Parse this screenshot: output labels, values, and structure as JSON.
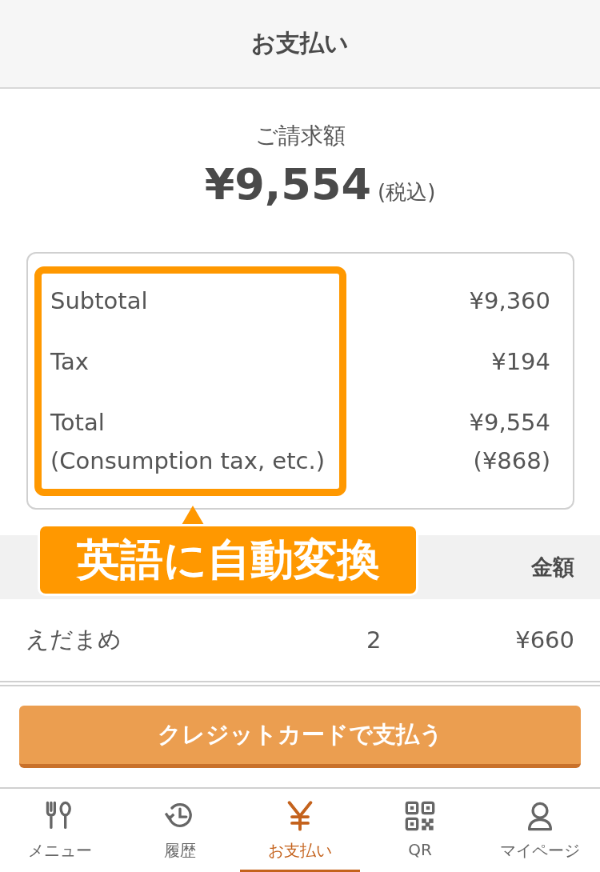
{
  "header": {
    "title": "お支払い"
  },
  "bill": {
    "label": "ご請求額",
    "amount": "¥9,554",
    "tax_note": "(税込)"
  },
  "summary": [
    {
      "label": "Subtotal",
      "value": "¥9,360"
    },
    {
      "label": "Tax",
      "value": "¥194"
    },
    {
      "label": "Total",
      "value": "¥9,554"
    },
    {
      "label": "(Consumption tax, etc.)",
      "value": "(¥868)"
    }
  ],
  "table": {
    "columns": [
      "金額"
    ],
    "rows": [
      {
        "item": "えだまめ",
        "qty": "2",
        "amount": "¥660"
      }
    ]
  },
  "pay_button": "クレジットカードで支払う",
  "annotation": {
    "text": "英語に自動変換"
  },
  "nav": [
    {
      "kind": "menu",
      "label": "メニュー",
      "selected": false
    },
    {
      "kind": "history",
      "label": "履歴",
      "selected": false
    },
    {
      "kind": "yen",
      "label": "お支払い",
      "selected": true
    },
    {
      "kind": "qr",
      "label": "QR",
      "selected": false
    },
    {
      "kind": "user",
      "label": "マイページ",
      "selected": false
    }
  ]
}
